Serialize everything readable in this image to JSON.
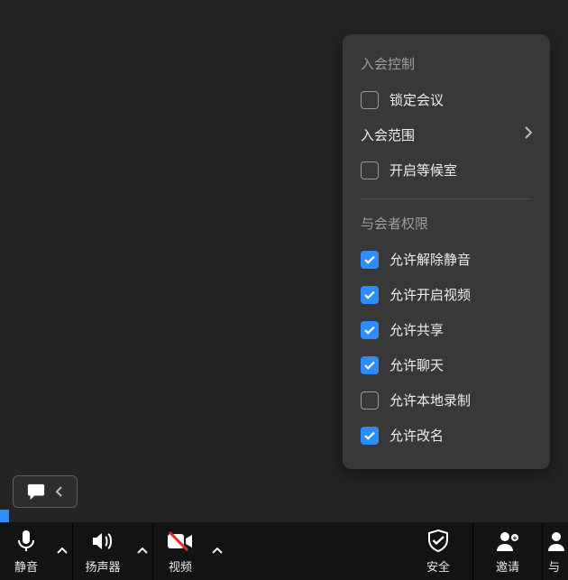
{
  "menu": {
    "section1_title": "入会控制",
    "lock_meeting": {
      "label": "锁定会议",
      "checked": false
    },
    "join_scope": {
      "label": "入会范围"
    },
    "waiting_room": {
      "label": "开启等候室",
      "checked": false
    },
    "section2_title": "与会者权限",
    "allow_unmute": {
      "label": "允许解除静音",
      "checked": true
    },
    "allow_video": {
      "label": "允许开启视频",
      "checked": true
    },
    "allow_share": {
      "label": "允许共享",
      "checked": true
    },
    "allow_chat": {
      "label": "允许聊天",
      "checked": true
    },
    "allow_local_record": {
      "label": "允许本地录制",
      "checked": false
    },
    "allow_rename": {
      "label": "允许改名",
      "checked": true
    }
  },
  "toolbar": {
    "mute": "静音",
    "speaker": "扬声器",
    "video": "视频",
    "security": "安全",
    "invite": "邀请",
    "participants_prefix": "与"
  }
}
